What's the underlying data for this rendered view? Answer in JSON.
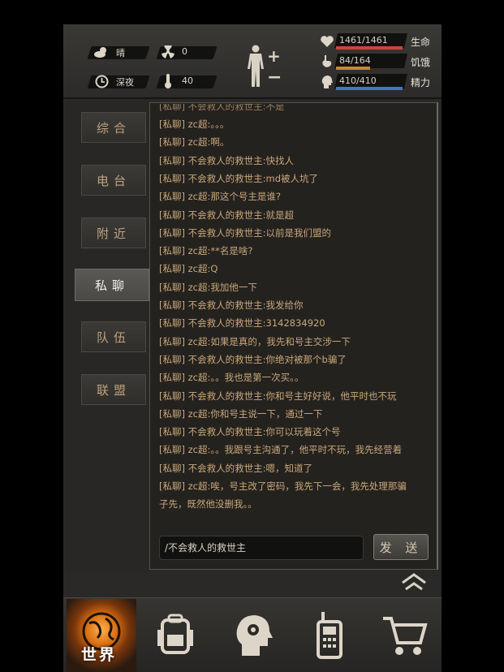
{
  "status": {
    "weather": "晴",
    "radiation": "0",
    "time_of_day": "深夜",
    "temperature": "40",
    "stats": [
      {
        "icon": "heart-icon",
        "value": "1461/1461",
        "label": "生命",
        "color": "#c9453f",
        "fill": 1.0
      },
      {
        "icon": "stomach-icon",
        "value": "84/164",
        "label": "饥饿",
        "color": "#c38a2e",
        "fill": 0.51
      },
      {
        "icon": "brain-icon",
        "value": "410/410",
        "label": "精力",
        "color": "#3e79c0",
        "fill": 1.0
      }
    ]
  },
  "tabs": [
    "综合",
    "电台",
    "附近",
    "私聊",
    "队伍",
    "联盟"
  ],
  "active_tab": "私聊",
  "chat": {
    "partial_top": "[私聊] 不会救人的救世主:不是",
    "messages": [
      {
        "tag": "[私聊]",
        "text": " zc超:。。。"
      },
      {
        "tag": "[私聊]",
        "text": " zc超:啊。"
      },
      {
        "tag": "[私聊]",
        "text": " 不会救人的救世主:快找人"
      },
      {
        "tag": "[私聊]",
        "text": " 不会救人的救世主:md被人坑了"
      },
      {
        "tag": "[私聊]",
        "text": " zc超:那这个号主是谁?"
      },
      {
        "tag": "[私聊]",
        "text": " 不会救人的救世主:就是超"
      },
      {
        "tag": "[私聊]",
        "text": " 不会救人的救世主:以前是我们盟的"
      },
      {
        "tag": "[私聊]",
        "text": " zc超:**名是啥?"
      },
      {
        "tag": "[私聊]",
        "text": " zc超:Q"
      },
      {
        "tag": "[私聊]",
        "text": " zc超:我加他一下"
      },
      {
        "tag": "[私聊]",
        "text": " 不会救人的救世主:我发给你"
      },
      {
        "tag": "[私聊]",
        "text": " 不会救人的救世主:3142834920"
      },
      {
        "tag": "[私聊]",
        "text": " zc超:如果是真的，我先和号主交涉一下"
      },
      {
        "tag": "[私聊]",
        "text": " 不会救人的救世主:你绝对被那个b骗了"
      },
      {
        "tag": "[私聊]",
        "text": " zc超:。。我也是第一次买。。"
      },
      {
        "tag": "[私聊]",
        "text": " 不会救人的救世主:你和号主好好说，他平时也不玩"
      },
      {
        "tag": "[私聊]",
        "text": " zc超:你和号主说一下，通过一下"
      },
      {
        "tag": "[私聊]",
        "text": " 不会救人的救世主:你可以玩着这个号"
      },
      {
        "tag": "[私聊]",
        "text": " zc超:。。我跟号主沟通了，他平时不玩，我先经营着"
      },
      {
        "tag": "[私聊]",
        "text": " 不会救人的救世主:嗯，知道了"
      },
      {
        "tag": "[私聊]",
        "text": " zc超:唉，号主改了密码，我先下一会，我先处理那骗"
      },
      {
        "tag": "",
        "text": "子先，既然他没删我。。"
      }
    ],
    "input_value": "/不会救人的救世主",
    "send_label": "发 送"
  },
  "bottom": {
    "world_label": "世界"
  }
}
